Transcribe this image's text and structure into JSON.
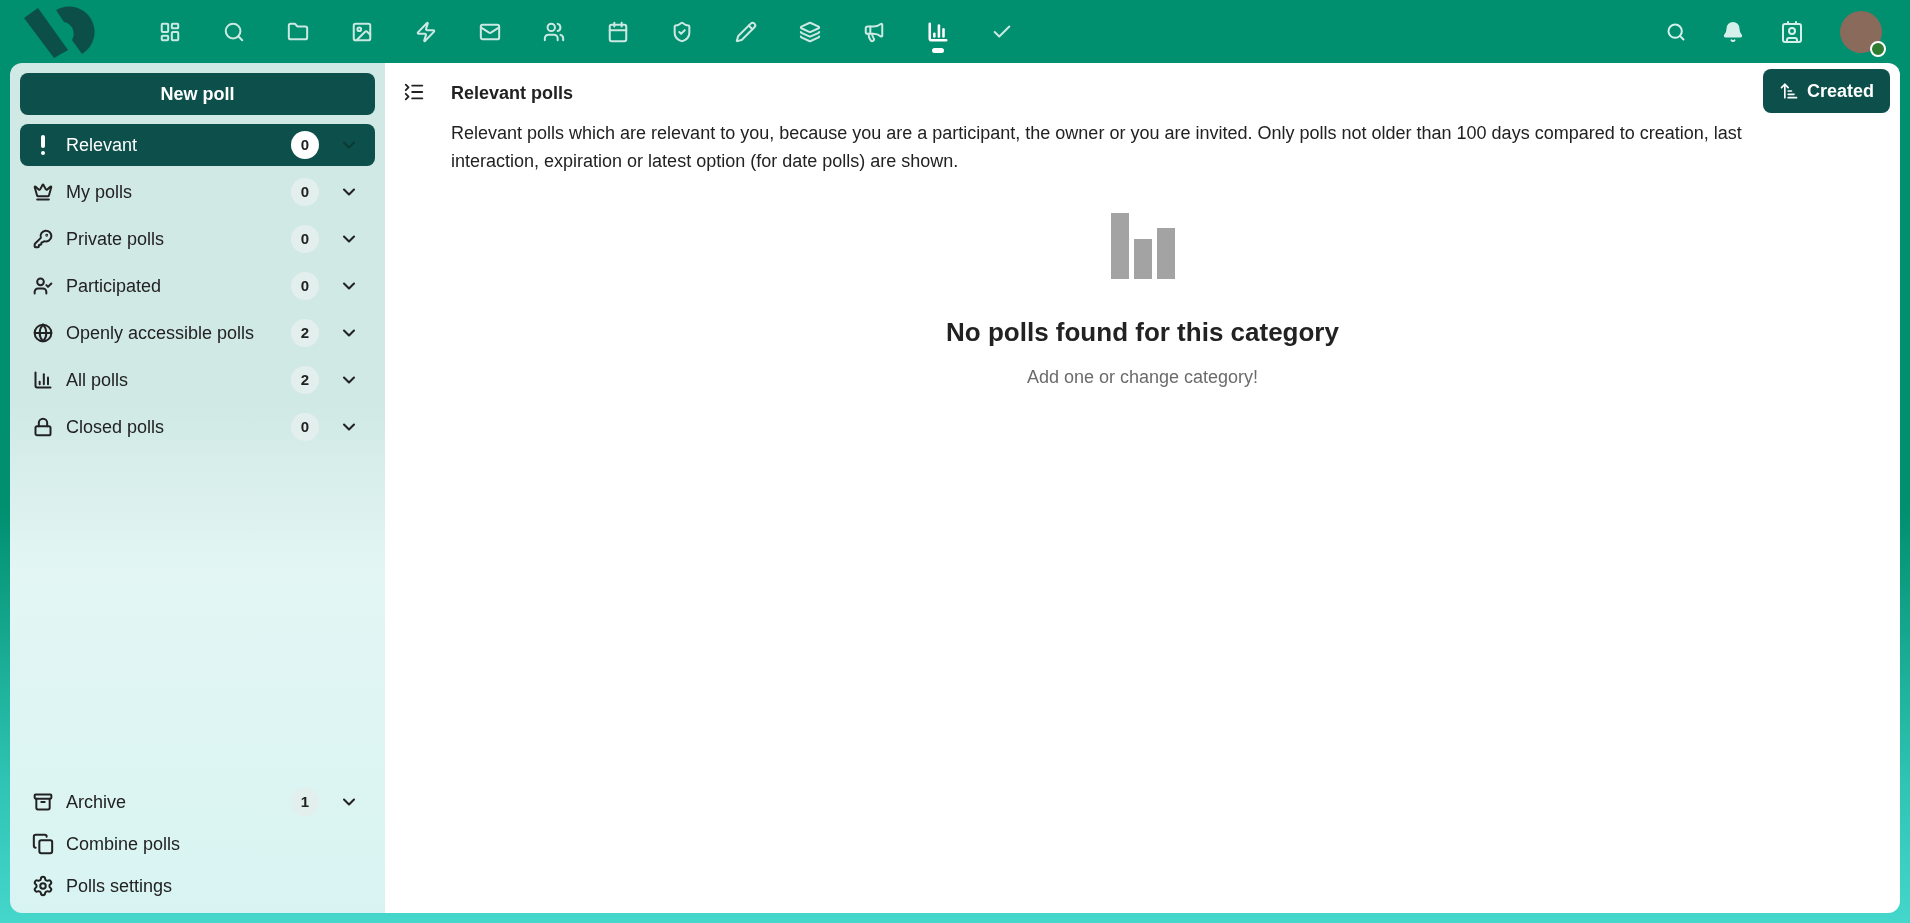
{
  "header": {
    "apps": [
      {
        "selected": false
      },
      {
        "selected": false
      },
      {
        "selected": false
      },
      {
        "selected": false
      },
      {
        "selected": false
      },
      {
        "selected": false
      },
      {
        "selected": false
      },
      {
        "selected": false
      },
      {
        "selected": false
      },
      {
        "selected": false
      },
      {
        "selected": false
      },
      {
        "selected": false
      },
      {
        "selected": true
      },
      {
        "selected": false
      }
    ]
  },
  "sidebar": {
    "new_poll": "New poll",
    "items": [
      {
        "label": "Relevant",
        "count": "0",
        "selected": true
      },
      {
        "label": "My polls",
        "count": "0",
        "selected": false
      },
      {
        "label": "Private polls",
        "count": "0",
        "selected": false
      },
      {
        "label": "Participated",
        "count": "0",
        "selected": false
      },
      {
        "label": "Openly accessible polls",
        "count": "2",
        "selected": false
      },
      {
        "label": "All polls",
        "count": "2",
        "selected": false
      },
      {
        "label": "Closed polls",
        "count": "0",
        "selected": false
      }
    ],
    "archive": {
      "label": "Archive",
      "count": "1",
      "selected": false
    },
    "footer": [
      "Combine polls",
      "Polls settings"
    ]
  },
  "main": {
    "title": "Relevant polls",
    "sort_button": "Created",
    "description": "Relevant polls which are relevant to you, because you are a participant, the owner or you are invited. Only polls not older than 100 days compared to creation, last interaction, expiration or latest option (for date polls) are shown.",
    "empty_title": "No polls found for this category",
    "empty_hint": "Add one or change category!"
  }
}
